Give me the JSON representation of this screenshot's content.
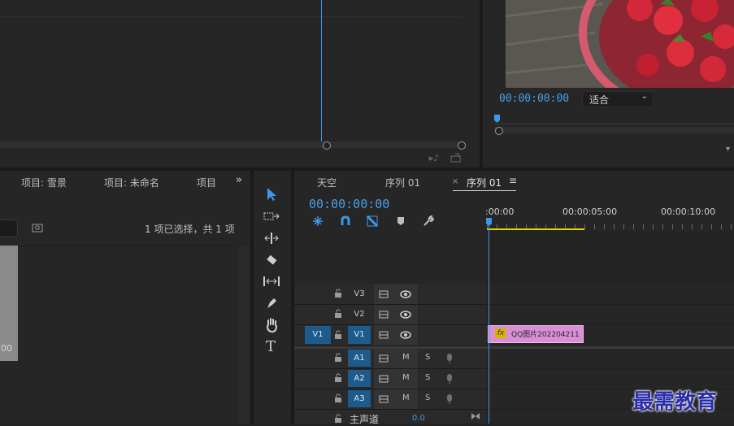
{
  "program_monitor": {
    "timecode": "00:00:00:00",
    "fit_label": "适合"
  },
  "project_panel": {
    "tabs": [
      "项目: 雪景",
      "项目: 未命名",
      "项目"
    ],
    "selection_info": "1 项已选择，共 1 项",
    "clip_duration": "00"
  },
  "timeline": {
    "tabs": [
      "天空",
      "序列 01",
      "序列 01"
    ],
    "timecode": "00:00:00:00",
    "ruler": [
      ":00:00",
      "00:00:05:00",
      "00:00:10:00"
    ],
    "tracks": [
      {
        "name": "V3",
        "source": ""
      },
      {
        "name": "V2",
        "source": ""
      },
      {
        "name": "V1",
        "source": "V1"
      },
      {
        "name": "A1",
        "source": ""
      },
      {
        "name": "A2",
        "source": ""
      },
      {
        "name": "A3",
        "source": ""
      }
    ],
    "mute_label": "M",
    "solo_label": "S",
    "master": {
      "label": "主声道",
      "value": "0.0"
    },
    "clip": {
      "fx": "fx",
      "name": "QQ图片202204211"
    }
  },
  "watermark": "最需教育",
  "colors": {
    "accent": "#3d97e8",
    "clip": "#d88fd6",
    "in_out_bar": "#e2d400",
    "active_track": "#1d5b8c"
  }
}
